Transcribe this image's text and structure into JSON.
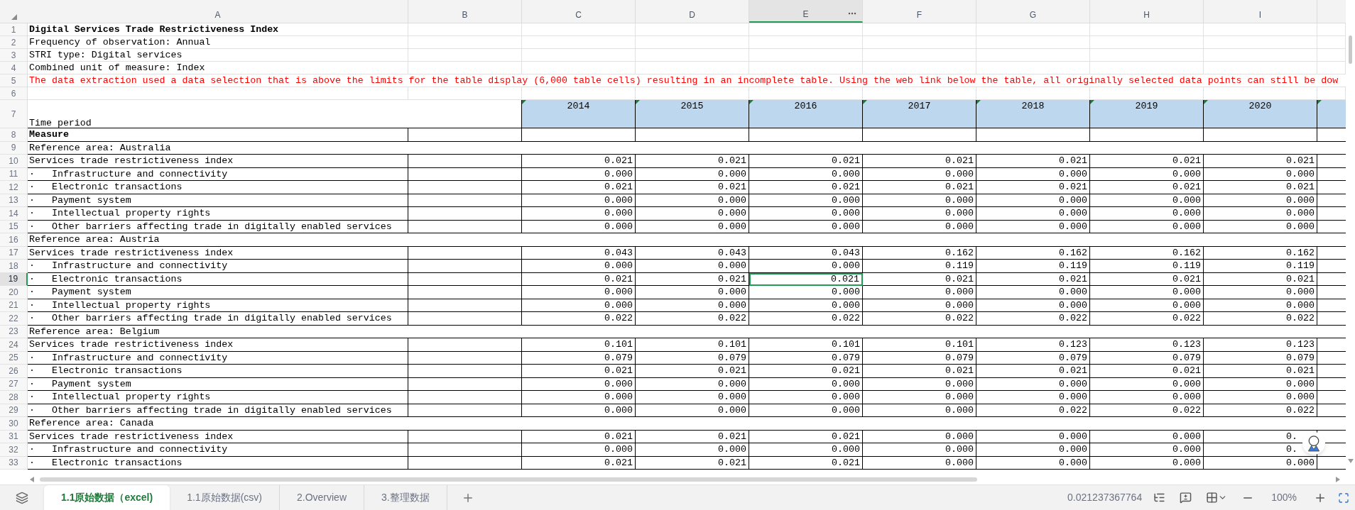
{
  "columns": [
    {
      "label": "A",
      "selected": false
    },
    {
      "label": "B",
      "selected": false
    },
    {
      "label": "C",
      "selected": false
    },
    {
      "label": "D",
      "selected": false
    },
    {
      "label": "E",
      "selected": true
    },
    {
      "label": "F",
      "selected": false
    },
    {
      "label": "G",
      "selected": false
    },
    {
      "label": "H",
      "selected": false
    },
    {
      "label": "I",
      "selected": false
    }
  ],
  "rows": [
    {
      "number": "1",
      "kind": "title",
      "text": "Digital Services Trade Restrictiveness Index",
      "selected": false
    },
    {
      "number": "2",
      "kind": "note",
      "text": "Frequency of observation: Annual",
      "selected": false
    },
    {
      "number": "3",
      "kind": "note",
      "text": "STRI type: Digital services",
      "selected": false
    },
    {
      "number": "4",
      "kind": "note",
      "text": "Combined unit of measure: Index",
      "selected": false
    },
    {
      "number": "5",
      "kind": "warning",
      "text": "The data extraction used a data selection that is above the limits for the table display (6,000 table cells) resulting in an incomplete table. Using the web link below the table, all originally selected data points can still be dow",
      "selected": false
    },
    {
      "number": "6",
      "kind": "blank",
      "selected": false
    },
    {
      "number": "7",
      "kind": "header",
      "text": "Time period",
      "years": [
        "2014",
        "2015",
        "2016",
        "2017",
        "2018",
        "2019",
        "2020"
      ],
      "selected": false
    },
    {
      "number": "8",
      "kind": "measure",
      "text": "Measure",
      "selected": false
    },
    {
      "number": "9",
      "kind": "area",
      "text": "Reference area: Australia",
      "selected": false
    },
    {
      "number": "10",
      "kind": "data",
      "text": "Services trade restrictiveness index",
      "values": [
        "0.021",
        "0.021",
        "0.021",
        "0.021",
        "0.021",
        "0.021",
        "0.021"
      ],
      "selected": false
    },
    {
      "number": "11",
      "kind": "data",
      "text": "·   Infrastructure and connectivity",
      "values": [
        "0.000",
        "0.000",
        "0.000",
        "0.000",
        "0.000",
        "0.000",
        "0.000"
      ],
      "selected": false
    },
    {
      "number": "12",
      "kind": "data",
      "text": "·   Electronic transactions",
      "values": [
        "0.021",
        "0.021",
        "0.021",
        "0.021",
        "0.021",
        "0.021",
        "0.021"
      ],
      "selected": false
    },
    {
      "number": "13",
      "kind": "data",
      "text": "·   Payment system",
      "values": [
        "0.000",
        "0.000",
        "0.000",
        "0.000",
        "0.000",
        "0.000",
        "0.000"
      ],
      "selected": false
    },
    {
      "number": "14",
      "kind": "data",
      "text": "·   Intellectual property rights",
      "values": [
        "0.000",
        "0.000",
        "0.000",
        "0.000",
        "0.000",
        "0.000",
        "0.000"
      ],
      "selected": false
    },
    {
      "number": "15",
      "kind": "data",
      "text": "·   Other barriers affecting trade in digitally enabled services",
      "values": [
        "0.000",
        "0.000",
        "0.000",
        "0.000",
        "0.000",
        "0.000",
        "0.000"
      ],
      "selected": false
    },
    {
      "number": "16",
      "kind": "area",
      "text": "Reference area: Austria",
      "selected": false
    },
    {
      "number": "17",
      "kind": "data",
      "text": "Services trade restrictiveness index",
      "values": [
        "0.043",
        "0.043",
        "0.043",
        "0.162",
        "0.162",
        "0.162",
        "0.162"
      ],
      "selected": false
    },
    {
      "number": "18",
      "kind": "data",
      "text": "·   Infrastructure and connectivity",
      "values": [
        "0.000",
        "0.000",
        "0.000",
        "0.119",
        "0.119",
        "0.119",
        "0.119"
      ],
      "selected": false
    },
    {
      "number": "19",
      "kind": "data",
      "text": "·   Electronic transactions",
      "values": [
        "0.021",
        "0.021",
        "0.021",
        "0.021",
        "0.021",
        "0.021",
        "0.021"
      ],
      "selected": true
    },
    {
      "number": "20",
      "kind": "data",
      "text": "·   Payment system",
      "values": [
        "0.000",
        "0.000",
        "0.000",
        "0.000",
        "0.000",
        "0.000",
        "0.000"
      ],
      "selected": false
    },
    {
      "number": "21",
      "kind": "data",
      "text": "·   Intellectual property rights",
      "values": [
        "0.000",
        "0.000",
        "0.000",
        "0.000",
        "0.000",
        "0.000",
        "0.000"
      ],
      "selected": false
    },
    {
      "number": "22",
      "kind": "data",
      "text": "·   Other barriers affecting trade in digitally enabled services",
      "values": [
        "0.022",
        "0.022",
        "0.022",
        "0.022",
        "0.022",
        "0.022",
        "0.022"
      ],
      "selected": false
    },
    {
      "number": "23",
      "kind": "area",
      "text": "Reference area: Belgium",
      "selected": false
    },
    {
      "number": "24",
      "kind": "data",
      "text": "Services trade restrictiveness index",
      "values": [
        "0.101",
        "0.101",
        "0.101",
        "0.101",
        "0.123",
        "0.123",
        "0.123"
      ],
      "selected": false
    },
    {
      "number": "25",
      "kind": "data",
      "text": "·   Infrastructure and connectivity",
      "values": [
        "0.079",
        "0.079",
        "0.079",
        "0.079",
        "0.079",
        "0.079",
        "0.079"
      ],
      "selected": false
    },
    {
      "number": "26",
      "kind": "data",
      "text": "·   Electronic transactions",
      "values": [
        "0.021",
        "0.021",
        "0.021",
        "0.021",
        "0.021",
        "0.021",
        "0.021"
      ],
      "selected": false
    },
    {
      "number": "27",
      "kind": "data",
      "text": "·   Payment system",
      "values": [
        "0.000",
        "0.000",
        "0.000",
        "0.000",
        "0.000",
        "0.000",
        "0.000"
      ],
      "selected": false
    },
    {
      "number": "28",
      "kind": "data",
      "text": "·   Intellectual property rights",
      "values": [
        "0.000",
        "0.000",
        "0.000",
        "0.000",
        "0.000",
        "0.000",
        "0.000"
      ],
      "selected": false
    },
    {
      "number": "29",
      "kind": "data",
      "text": "·   Other barriers affecting trade in digitally enabled services",
      "values": [
        "0.000",
        "0.000",
        "0.000",
        "0.000",
        "0.022",
        "0.022",
        "0.022"
      ],
      "selected": false
    },
    {
      "number": "30",
      "kind": "area",
      "text": "Reference area: Canada",
      "selected": false
    },
    {
      "number": "31",
      "kind": "data",
      "text": "Services trade restrictiveness index",
      "values": [
        "0.021",
        "0.021",
        "0.021",
        "0.000",
        "0.000",
        "0.000",
        "0."
      ],
      "selected": false
    },
    {
      "number": "32",
      "kind": "data",
      "text": "·   Infrastructure and connectivity",
      "values": [
        "0.000",
        "0.000",
        "0.000",
        "0.000",
        "0.000",
        "0.000",
        "0."
      ],
      "selected": false
    },
    {
      "number": "33",
      "kind": "data",
      "text": "·   Electronic transactions",
      "values": [
        "0.021",
        "0.021",
        "0.021",
        "0.000",
        "0.000",
        "0.000",
        "0.000"
      ],
      "selected": false
    }
  ],
  "sheet_tabs": [
    {
      "label": "1.1原始数据（excel)",
      "selected": true
    },
    {
      "label": "1.1原始数据(csv)",
      "selected": false
    },
    {
      "label": "2.Overview",
      "selected": false
    },
    {
      "label": "3.整理数据",
      "selected": false
    }
  ],
  "status_bar": {
    "cell_value": "0.021237367764",
    "zoom": "100%"
  }
}
